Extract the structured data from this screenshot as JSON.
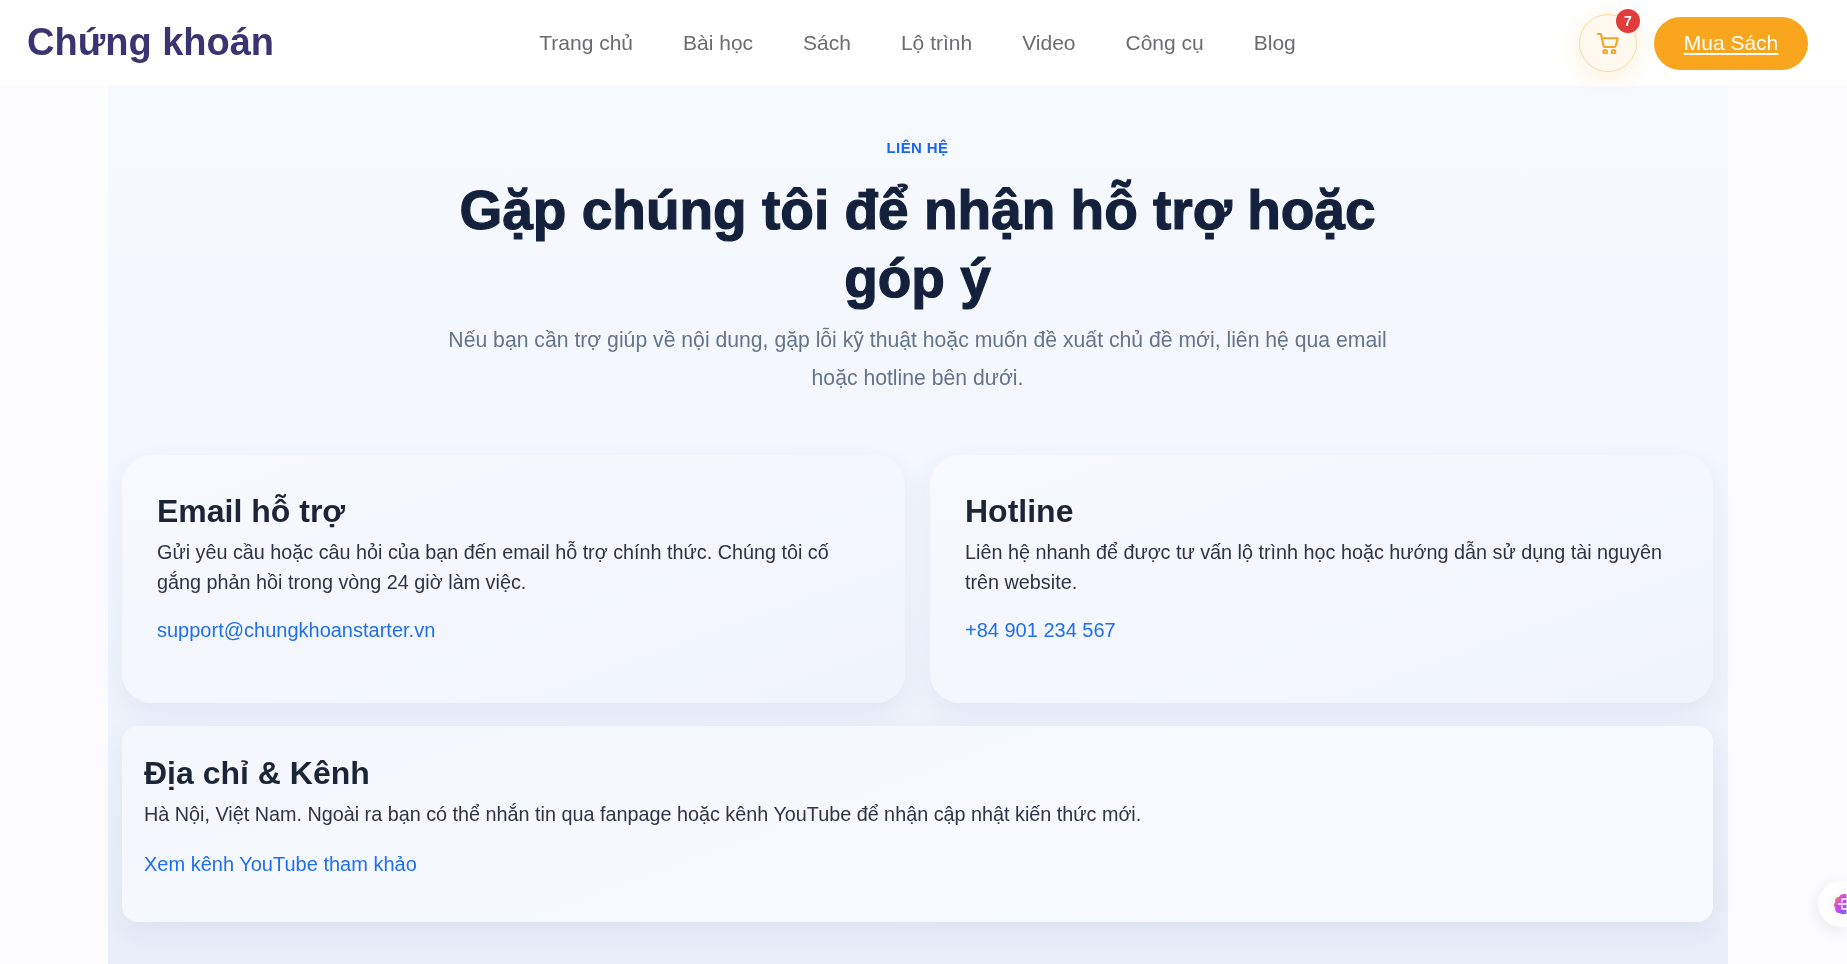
{
  "header": {
    "logo": "Chứng khoán",
    "nav": [
      "Trang chủ",
      "Bài học",
      "Sách",
      "Lộ trình",
      "Video",
      "Công cụ",
      "Blog"
    ],
    "cart": {
      "count": "7"
    },
    "cta": "Mua Sách"
  },
  "hero": {
    "eyebrow": "LIÊN HỆ",
    "title": "Gặp chúng tôi để nhận hỗ trợ hoặc góp ý",
    "subtitle": "Nếu bạn cần trợ giúp về nội dung, gặp lỗi kỹ thuật hoặc muốn đề xuất chủ đề mới, liên hệ qua email hoặc hotline bên dưới."
  },
  "contact_cards": [
    {
      "title": "Email hỗ trợ",
      "text": "Gửi yêu cầu hoặc câu hỏi của bạn đến email hỗ trợ chính thức. Chúng tôi cố gắng phản hồi trong vòng 24 giờ làm việc.",
      "link": "support@chungkhoanstarter.vn"
    },
    {
      "title": "Hotline",
      "text": "Liên hệ nhanh để được tư vấn lộ trình học hoặc hướng dẫn sử dụng tài nguyên trên website.",
      "link": "+84 901 234 567"
    }
  ],
  "address_card": {
    "title": "Địa chỉ & Kênh",
    "text": "Hà Nội, Việt Nam. Ngoài ra bạn có thể nhắn tin qua fanpage hoặc kênh YouTube để nhận cập nhật kiến thức mới.",
    "link": "Xem kênh YouTube tham khảo"
  }
}
